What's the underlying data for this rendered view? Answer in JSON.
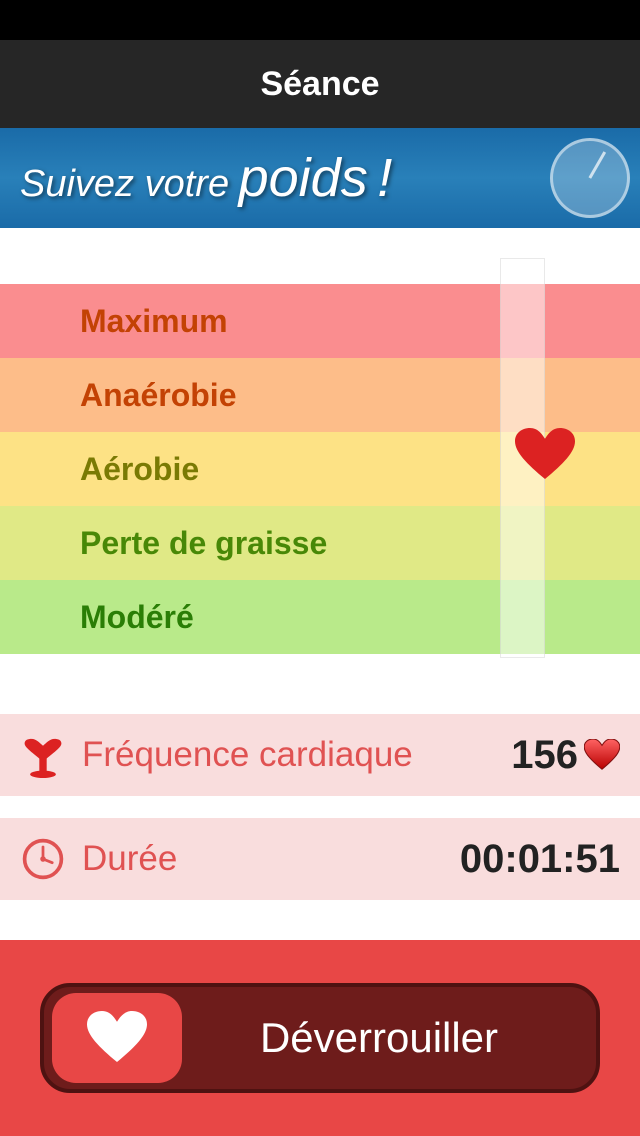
{
  "header": {
    "title": "Séance"
  },
  "banner": {
    "text_part1": "Suivez votre",
    "text_part2": "poids",
    "text_part3": "!"
  },
  "zones": [
    {
      "label": "Maximum",
      "class": "zone-max"
    },
    {
      "label": "Anaérobie",
      "class": "zone-anaerobic"
    },
    {
      "label": "Aérobie",
      "class": "zone-aerobic"
    },
    {
      "label": "Perte de graisse",
      "class": "zone-fatloss"
    },
    {
      "label": "Modéré",
      "class": "zone-moderate"
    }
  ],
  "info": {
    "heartrate": {
      "label": "Fréquence cardiaque",
      "value": "156"
    },
    "duration": {
      "label": "Durée",
      "value": "00:01:51"
    }
  },
  "unlock": {
    "label": "Déverrouiller"
  }
}
